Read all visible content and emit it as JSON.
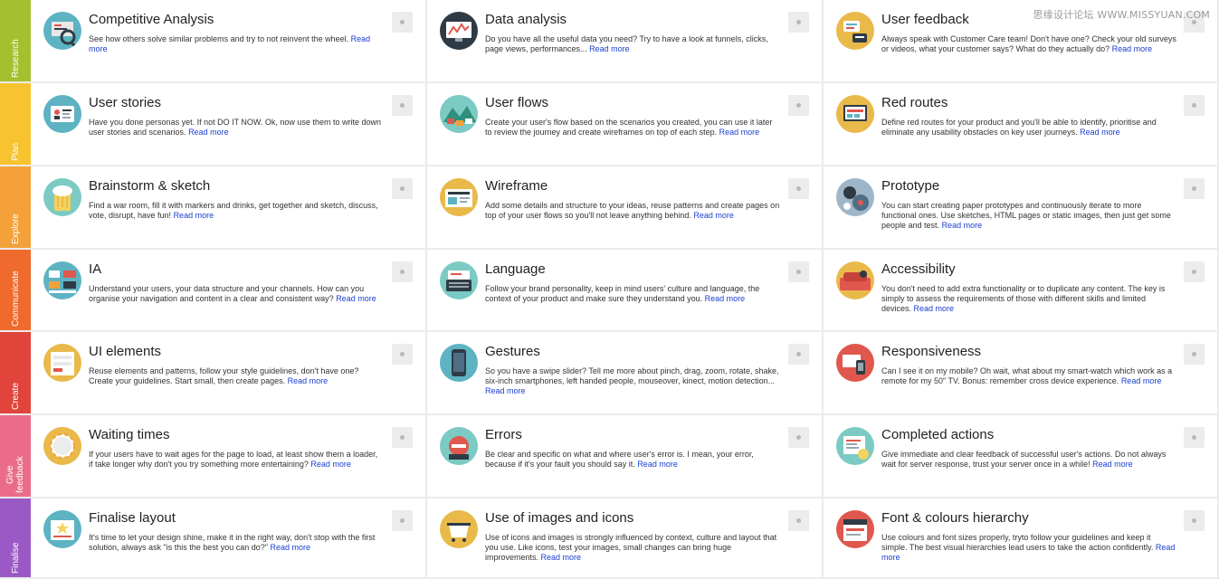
{
  "watermark": "思缘设计论坛 WWW.MISSYUAN.COM",
  "read_more": "Read more",
  "stages": [
    {
      "label": "Research",
      "color": "#a5c02e"
    },
    {
      "label": "Plan",
      "color": "#f7c32e"
    },
    {
      "label": "Explore",
      "color": "#f4a13a"
    },
    {
      "label": "Communicate",
      "color": "#ef6a2c"
    },
    {
      "label": "Create",
      "color": "#e0443b"
    },
    {
      "label": "Give feedback",
      "color": "#ea6c8a"
    },
    {
      "label": "Finalise",
      "color": "#9b59c6"
    }
  ],
  "rows": [
    [
      {
        "title": "Competitive Analysis",
        "text": "See how others solve similar problems and try to not reinvent the wheel.",
        "icon": "competitive-analysis-icon",
        "bg": "#5db3c2"
      },
      {
        "title": "Data analysis",
        "text": "Do you have all the useful data you need? Try to have a look at funnels, clicks, page views, performances...",
        "icon": "data-analysis-icon",
        "bg": "#2f3b44"
      },
      {
        "title": "User feedback",
        "text": "Always speak with Customer Care team! Don't have one? Check your old surveys or videos, what your customer says? What do they actually do?",
        "icon": "user-feedback-icon",
        "bg": "#e9b94a"
      }
    ],
    [
      {
        "title": "User stories",
        "text": "Have you done personas yet. If not DO IT NOW. Ok, now use them to write down user stories and scenarios.",
        "icon": "user-stories-icon",
        "bg": "#5db3c2"
      },
      {
        "title": "User flows",
        "text": "Create your user's flow based on the scenarios you created, you can use it later to review the journey and create wireframes on top of each step.",
        "icon": "user-flows-icon",
        "bg": "#7ccac4"
      },
      {
        "title": "Red routes",
        "text": "Define red routes for your product and you'll be able to identify, prioritise and eliminate any usability obstacles on key user journeys.",
        "icon": "red-routes-icon",
        "bg": "#e9b94a"
      }
    ],
    [
      {
        "title": "Brainstorm & sketch",
        "text": "Find a war room, fill it with markers and drinks, get together and sketch, discuss, vote, disrupt, have fun!",
        "icon": "brainstorm-icon",
        "bg": "#7ccac4"
      },
      {
        "title": "Wireframe",
        "text": "Add some details and structure to your ideas, reuse patterns and create pages on top of your user flows so you'll not leave anything behind.",
        "icon": "wireframe-icon",
        "bg": "#e9b94a"
      },
      {
        "title": "Prototype",
        "text": "You can start creating paper prototypes and continuously iterate to more functional ones. Use sketches, HTML pages or static images, then just get some people and test.",
        "icon": "prototype-icon",
        "bg": "#9fb6c9"
      }
    ],
    [
      {
        "title": "IA",
        "text": "Understand your users, your data structure and your channels. How can you organise your navigation and content in a clear and consistent way?",
        "icon": "ia-icon",
        "bg": "#5db3c2"
      },
      {
        "title": "Language",
        "text": "Follow your brand personality, keep in mind users' culture and language, the context of your product and make sure they understand you.",
        "icon": "language-icon",
        "bg": "#7ccac4"
      },
      {
        "title": "Accessibility",
        "text": "You don't need to add extra functionality or to duplicate any content. The key is simply to assess the requirements of those with different skills and limited devices.",
        "icon": "accessibility-icon",
        "bg": "#e9b94a"
      }
    ],
    [
      {
        "title": "UI elements",
        "text": "Reuse elements and patterns, follow your style guidelines, don't have one? Create your guidelines. Start small, then create pages.",
        "icon": "ui-elements-icon",
        "bg": "#e9b94a"
      },
      {
        "title": "Gestures",
        "text": "So you have a swipe slider? Tell me more about pinch, drag, zoom, rotate, shake, six-inch smartphones, left handed people, mouseover, kinect, motion detection...",
        "icon": "gestures-icon",
        "bg": "#5db3c2"
      },
      {
        "title": "Responsiveness",
        "text": "Can I see it on my mobile? Oh wait, what about my smart-watch which work as a remote for my 50\" TV. Bonus: remember cross device experience.",
        "icon": "responsiveness-icon",
        "bg": "#e0574d"
      }
    ],
    [
      {
        "title": "Waiting times",
        "text": "If your users have to wait ages for the page to load, at least show them a loader, if take longer why don't you try something more entertaining?",
        "icon": "waiting-times-icon",
        "bg": "#e9b94a"
      },
      {
        "title": "Errors",
        "text": "Be clear and specific on what and where user's error is. I mean, your error, because if it's your fault you should say it.",
        "icon": "errors-icon",
        "bg": "#7ccac4"
      },
      {
        "title": "Completed actions",
        "text": "Give immediate and clear feedback of successful user's actions. Do not always wait for server response, trust your server once in a while!",
        "icon": "completed-actions-icon",
        "bg": "#7ccac4"
      }
    ],
    [
      {
        "title": "Finalise layout",
        "text": "It's time to let your design shine, make it in the right way, don't stop with the first solution, always ask \"is this the best you can do?\"",
        "icon": "finalise-layout-icon",
        "bg": "#5db3c2"
      },
      {
        "title": "Use of images and icons",
        "text": "Use of icons and images is strongly influenced by context, culture and layout that you use. Like icons, test your images, small changes can bring huge improvements.",
        "icon": "images-icons-icon",
        "bg": "#e9b94a"
      },
      {
        "title": "Font & colours hierarchy",
        "text": "Use colours and font sizes properly, tryto follow your guidelines and keep it simple. The best visual hierarchies lead users to take the action confidently.",
        "icon": "font-colours-icon",
        "bg": "#e0574d"
      }
    ]
  ]
}
